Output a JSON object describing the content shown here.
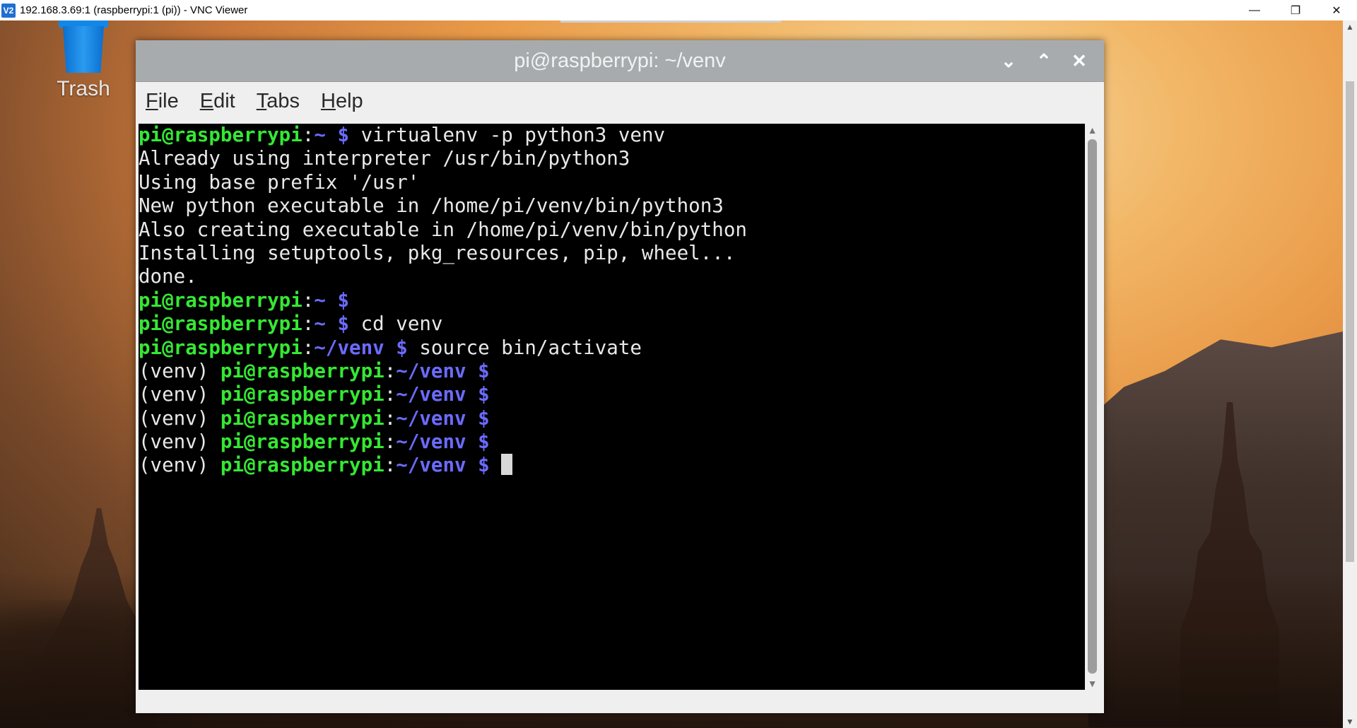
{
  "vnc": {
    "title": "192.168.3.69:1 (raspberrypi:1 (pi)) - VNC Viewer",
    "app_icon": "V2",
    "minimize": "—",
    "restore": "❐",
    "close": "✕"
  },
  "desktop": {
    "trash_label": "Trash"
  },
  "terminal": {
    "title": "pi@raspberrypi: ~/venv",
    "controls": {
      "minimize": "⌄",
      "maximize": "⌃",
      "close": "✕"
    },
    "menu": {
      "file": {
        "u": "F",
        "rest": "ile"
      },
      "edit": {
        "u": "E",
        "rest": "dit"
      },
      "tabs": {
        "u": "T",
        "rest": "abs"
      },
      "help": {
        "u": "H",
        "rest": "elp"
      }
    },
    "lines": {
      "l1": {
        "user": "pi@raspberrypi",
        "sep": ":",
        "path": "~ $",
        "cmd": " virtualenv -p python3 venv"
      },
      "l2": {
        "text": "Already using interpreter /usr/bin/python3"
      },
      "l3": {
        "text": "Using base prefix '/usr'"
      },
      "l4": {
        "text": "New python executable in /home/pi/venv/bin/python3"
      },
      "l5": {
        "text": "Also creating executable in /home/pi/venv/bin/python"
      },
      "l6": {
        "text": "Installing setuptools, pkg_resources, pip, wheel..."
      },
      "l7": {
        "text": "done."
      },
      "l8": {
        "user": "pi@raspberrypi",
        "sep": ":",
        "path": "~ $",
        "cmd": ""
      },
      "l9": {
        "user": "pi@raspberrypi",
        "sep": ":",
        "path": "~ $",
        "cmd": " cd venv"
      },
      "l10": {
        "user": "pi@raspberrypi",
        "sep": ":",
        "path": "~/venv $",
        "cmd": " source bin/activate"
      },
      "l11": {
        "env": "(venv) ",
        "user": "pi@raspberrypi",
        "sep": ":",
        "path": "~/venv $"
      },
      "l12": {
        "env": "(venv) ",
        "user": "pi@raspberrypi",
        "sep": ":",
        "path": "~/venv $"
      },
      "l13": {
        "env": "(venv) ",
        "user": "pi@raspberrypi",
        "sep": ":",
        "path": "~/venv $"
      },
      "l14": {
        "env": "(venv) ",
        "user": "pi@raspberrypi",
        "sep": ":",
        "path": "~/venv $"
      },
      "l15": {
        "env": "(venv) ",
        "user": "pi@raspberrypi",
        "sep": ":",
        "path": "~/venv $"
      }
    },
    "scroll_up": "▲",
    "scroll_down": "▼"
  },
  "vnc_scroll": {
    "up": "▲",
    "down": "▼"
  },
  "colors": {
    "prompt_user": "#35e833",
    "prompt_path": "#6b6bff",
    "terminal_bg": "#000000",
    "titlebar": "#a7abae"
  }
}
